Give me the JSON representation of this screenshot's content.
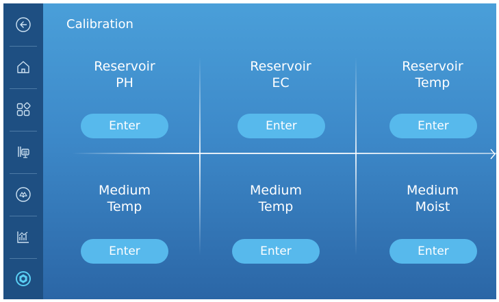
{
  "page": {
    "title": "Calibration"
  },
  "sidebar": {
    "items": [
      {
        "icon": "back-circle-icon"
      },
      {
        "icon": "home-icon"
      },
      {
        "icon": "apps-grid-icon"
      },
      {
        "icon": "device-panel-icon"
      },
      {
        "icon": "pump-icon"
      },
      {
        "icon": "chart-icon"
      },
      {
        "icon": "settings-gear-icon",
        "active": true
      }
    ]
  },
  "calibration": {
    "cells": [
      {
        "line1": "Reservoir",
        "line2": "PH",
        "button": "Enter"
      },
      {
        "line1": "Reservoir",
        "line2": "EC",
        "button": "Enter"
      },
      {
        "line1": "Reservoir",
        "line2": "Temp",
        "button": "Enter"
      },
      {
        "line1": "Medium",
        "line2": "Temp",
        "button": "Enter"
      },
      {
        "line1": "Medium",
        "line2": "Temp",
        "button": "Enter"
      },
      {
        "line1": "Medium",
        "line2": "Moist",
        "button": "Enter"
      }
    ]
  },
  "pager": {
    "next_icon": "chevron-right-icon"
  },
  "colors": {
    "sidebar_bg": "#1e4f82",
    "main_top": "#4a9fd9",
    "main_bottom": "#2b66a6",
    "button_bg": "#57b9ec",
    "active_icon": "#5ad0f5",
    "text": "#ffffff"
  }
}
